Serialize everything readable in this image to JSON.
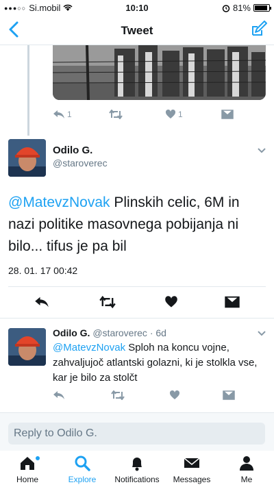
{
  "status_bar": {
    "carrier": "Si.mobil",
    "time": "10:10",
    "battery": "81%",
    "battery_level": 0.81
  },
  "nav": {
    "title": "Tweet"
  },
  "prev_tweet": {
    "reply_count": "1",
    "like_count": "1"
  },
  "main_tweet": {
    "name": "Odilo G.",
    "handle": "@staroverec",
    "mention": "@MatevzNovak",
    "text": " Plinskih celic, 6M in nazi politike masovnega pobijanja ni bilo... tifus je pa bil",
    "timestamp": "28. 01. 17 00:42"
  },
  "reply_tweet": {
    "name": "Odilo G.",
    "handle": "@staroverec",
    "age": "· 6d",
    "mention": "@MatevzNovak",
    "text": " Sploh na koncu vojne, zahvaljujoč atlantski golazni, ki je stolkla vse, kar je bilo za stolčt"
  },
  "reply_box": {
    "placeholder": "Reply to Odilo G."
  },
  "tabs": [
    {
      "label": "Home",
      "icon": "home-icon"
    },
    {
      "label": "Explore",
      "icon": "search-icon",
      "active": true
    },
    {
      "label": "Notifications",
      "icon": "bell-icon"
    },
    {
      "label": "Messages",
      "icon": "envelope-icon"
    },
    {
      "label": "Me",
      "icon": "person-icon"
    }
  ],
  "colors": {
    "accent": "#1da1f2",
    "muted": "#8899a6",
    "text": "#14171a"
  }
}
